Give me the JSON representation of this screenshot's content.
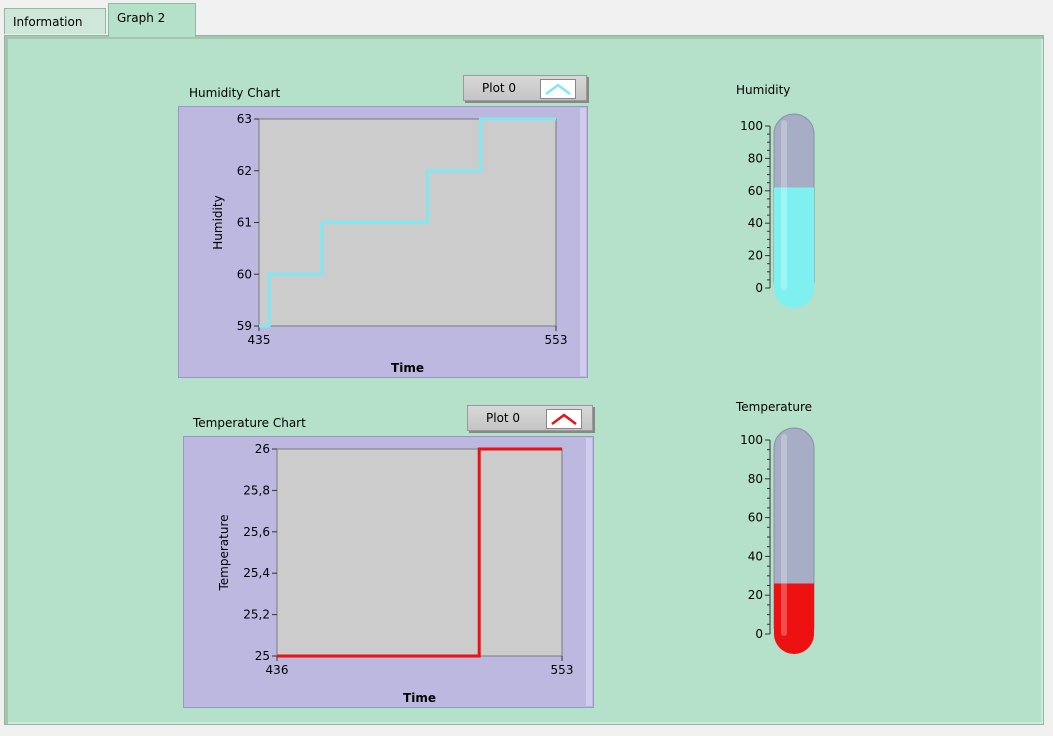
{
  "tabs": [
    {
      "label": "Information",
      "active": false
    },
    {
      "label": "Graph  2",
      "active": true
    }
  ],
  "humidity_chart": {
    "title": "Humidity Chart",
    "legend_label": "Plot 0",
    "plot_color": "#7fe8f0",
    "chart_data": {
      "type": "line",
      "xlabel": "Time",
      "ylabel": "Humidity",
      "xlim": [
        435,
        553
      ],
      "ylim": [
        59,
        63
      ],
      "x_ticks": [
        "435",
        "553"
      ],
      "y_ticks": [
        "59",
        "60",
        "61",
        "62",
        "63"
      ],
      "series": [
        {
          "x": [
            435,
            439,
            439,
            460,
            460,
            502,
            502,
            523,
            523,
            553
          ],
          "y": [
            59,
            59,
            60,
            60,
            61,
            61,
            62,
            62,
            63,
            63
          ]
        }
      ]
    }
  },
  "temperature_chart": {
    "title": "Temperature Chart",
    "legend_label": "Plot 0",
    "plot_color": "#ee1111",
    "chart_data": {
      "type": "line",
      "xlabel": "Time",
      "ylabel": "Temperature",
      "xlim": [
        436,
        553
      ],
      "ylim": [
        25,
        26
      ],
      "x_ticks": [
        "436",
        "553"
      ],
      "y_ticks": [
        "25",
        "25,2",
        "25,4",
        "25,6",
        "25,8",
        "26"
      ],
      "series": [
        {
          "x": [
            436,
            519,
            519,
            553
          ],
          "y": [
            25,
            25,
            26,
            26
          ]
        }
      ]
    }
  },
  "humidity_gauge": {
    "label": "Humidity",
    "value": 62,
    "scale": [
      0,
      100
    ],
    "ticks": [
      "0",
      "20",
      "40",
      "60",
      "80",
      "100"
    ],
    "fill_color": "#7ff0f0"
  },
  "temperature_gauge": {
    "label": "Temperature",
    "value": 26,
    "scale": [
      0,
      100
    ],
    "ticks": [
      "0",
      "20",
      "40",
      "60",
      "80",
      "100"
    ],
    "fill_color": "#ee1111"
  }
}
